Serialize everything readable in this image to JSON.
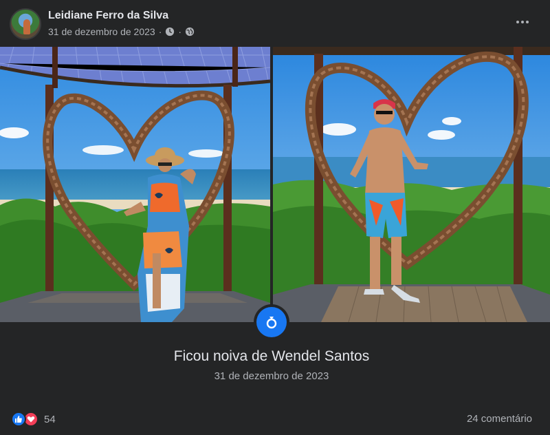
{
  "post": {
    "author": "Leidiane Ferro da Silva",
    "date": "31 de dezembro de 2023",
    "separator": "·",
    "icons": {
      "clock": "clock-icon",
      "audience": "globe-icon",
      "more": "more-options-icon",
      "event": "ring-icon",
      "like": "like-icon",
      "love": "love-icon"
    }
  },
  "event": {
    "title": "Ficou noiva de Wendel Santos",
    "date": "31 de dezembro de 2023"
  },
  "footer": {
    "reaction_count": "54",
    "comments_label": "24 comentário"
  },
  "colors": {
    "background": "#242526",
    "accent": "#1877f2",
    "love": "#f33e58",
    "text_primary": "#e4e6eb",
    "text_secondary": "#b0b3b8"
  }
}
